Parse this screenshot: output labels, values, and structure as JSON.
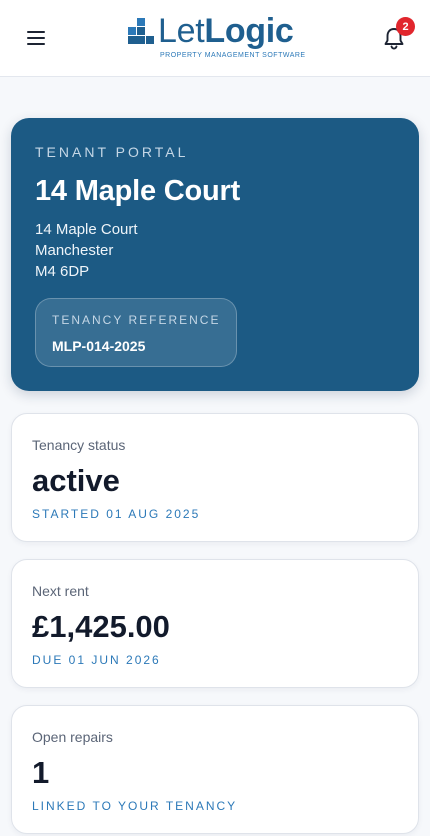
{
  "header": {
    "brand_part1": "Let",
    "brand_part2": "Logic",
    "tagline": "PROPERTY MANAGEMENT SOFTWARE",
    "menu_icon": "hamburger-icon",
    "notifications_icon": "bell-icon",
    "notifications_count": "2"
  },
  "hero": {
    "eyebrow": "TENANT PORTAL",
    "title": "14 Maple Court",
    "address": [
      "14 Maple Court",
      "Manchester",
      "M4 6DP"
    ],
    "reference_label": "TENANCY REFERENCE",
    "reference_value": "MLP-014-2025"
  },
  "cards": [
    {
      "label": "Tenancy status",
      "value": "active",
      "sub": "STARTED 01 AUG 2025"
    },
    {
      "label": "Next rent",
      "value": "£1,425.00",
      "sub": "DUE 01 JUN 2026"
    },
    {
      "label": "Open repairs",
      "value": "1",
      "sub": "LINKED TO YOUR TENANCY"
    }
  ],
  "colors": {
    "brand": "#1f5f8f",
    "hero_bg": "#1c5a84",
    "accent_text": "#2c79b8",
    "badge": "#e1262d"
  }
}
